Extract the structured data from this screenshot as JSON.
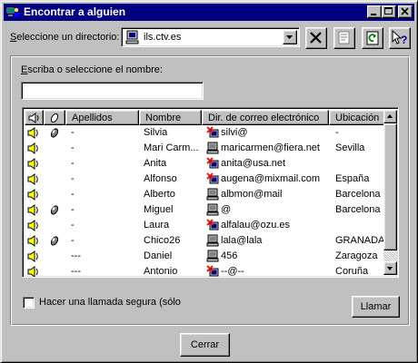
{
  "window": {
    "title": "Encontrar a alguien"
  },
  "directory": {
    "label": "Seleccione un directorio:",
    "label_accel": "S",
    "label_rest": "eleccione un directorio:",
    "value": "ils.ctv.es"
  },
  "name_search": {
    "label_accel": "E",
    "label_rest": "scriba o seleccione el nombre:",
    "value": ""
  },
  "list": {
    "columns": [
      "",
      "",
      "Apellidos",
      "Nombre",
      "Dir. de correo electrónico",
      "Ubicación"
    ],
    "rows": [
      {
        "audio": true,
        "video": true,
        "surname": "-",
        "name": "Silvia",
        "email": "silvi@",
        "location": "-",
        "icon": "person-red"
      },
      {
        "audio": true,
        "video": false,
        "surname": "-",
        "name": "Mari Carm...",
        "email": "maricarmen@fiera.net",
        "location": "Sevilla",
        "icon": "computer"
      },
      {
        "audio": true,
        "video": false,
        "surname": "-",
        "name": "Anita",
        "email": "anita@usa.net",
        "location": "",
        "icon": "person-red"
      },
      {
        "audio": true,
        "video": false,
        "surname": "-",
        "name": "Alfonso",
        "email": "augena@mixmail.com",
        "location": "España",
        "icon": "person-red"
      },
      {
        "audio": true,
        "video": false,
        "surname": "-",
        "name": "Alberto",
        "email": "albmon@mail",
        "location": "Barcelona",
        "icon": "computer"
      },
      {
        "audio": true,
        "video": true,
        "surname": "-",
        "name": "Miguel",
        "email": "@",
        "location": "Barcelona",
        "icon": "computer"
      },
      {
        "audio": true,
        "video": false,
        "surname": "-",
        "name": "Laura",
        "email": "alfalau@ozu.es",
        "location": "",
        "icon": "person-red"
      },
      {
        "audio": true,
        "video": true,
        "surname": "-",
        "name": "Chico26",
        "email": "lala@lala",
        "location": "GRANADA",
        "icon": "computer"
      },
      {
        "audio": true,
        "video": false,
        "surname": "---",
        "name": "Daniel",
        "email": "456",
        "location": "Zaragoza",
        "icon": "computer"
      },
      {
        "audio": true,
        "video": false,
        "surname": "---",
        "name": "Antonio",
        "email": "--@--",
        "location": "Coruña",
        "icon": "person-red"
      }
    ]
  },
  "secure_call": {
    "label": "Hacer una llamada segura (sólo",
    "checked": false
  },
  "buttons": {
    "call": "Llamar",
    "close": "Cerrar"
  },
  "colors": {
    "titlebar": "#000080",
    "face": "#c0c0c0"
  }
}
